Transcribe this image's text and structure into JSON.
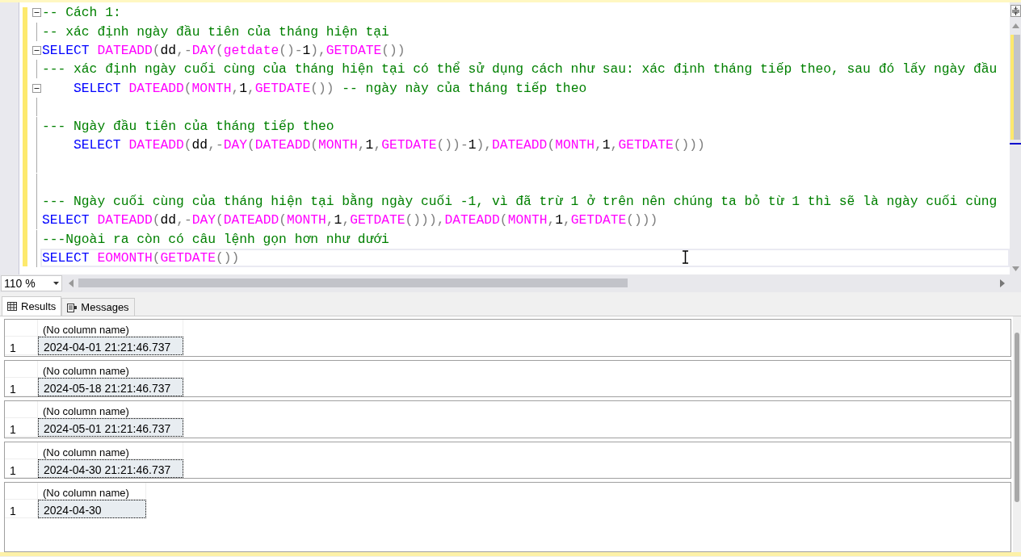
{
  "editor": {
    "lines": [
      {
        "fold": true,
        "current": false,
        "indented": false,
        "tokens": [
          {
            "kind": "comment",
            "text": "-- Cách 1:"
          }
        ]
      },
      {
        "fold": false,
        "current": false,
        "indented": false,
        "tokens": [
          {
            "kind": "comment",
            "text": "-- xác định ngày đầu tiên của tháng hiện tại"
          }
        ]
      },
      {
        "fold": true,
        "current": false,
        "indented": false,
        "tokens": [
          {
            "kind": "keyword",
            "text": "SELECT "
          },
          {
            "kind": "function",
            "text": "DATEADD"
          },
          {
            "kind": "operator",
            "text": "("
          },
          {
            "kind": "plain",
            "text": "dd"
          },
          {
            "kind": "operator",
            "text": ",-"
          },
          {
            "kind": "function",
            "text": "DAY"
          },
          {
            "kind": "operator",
            "text": "("
          },
          {
            "kind": "function",
            "text": "getdate"
          },
          {
            "kind": "operator",
            "text": "()-"
          },
          {
            "kind": "plain",
            "text": "1"
          },
          {
            "kind": "operator",
            "text": "),"
          },
          {
            "kind": "function",
            "text": "GETDATE"
          },
          {
            "kind": "operator",
            "text": "())"
          }
        ]
      },
      {
        "fold": false,
        "current": false,
        "indented": false,
        "tokens": [
          {
            "kind": "comment",
            "text": "--- xác định ngày cuối cùng của tháng hiện tại có thể sử dụng cách như sau: xác định tháng tiếp theo, sau đó lấy ngày đầu"
          }
        ]
      },
      {
        "fold": true,
        "current": false,
        "indented": true,
        "tokens": [
          {
            "kind": "keyword",
            "text": "SELECT "
          },
          {
            "kind": "function",
            "text": "DATEADD"
          },
          {
            "kind": "operator",
            "text": "("
          },
          {
            "kind": "function",
            "text": "MONTH"
          },
          {
            "kind": "operator",
            "text": ","
          },
          {
            "kind": "plain",
            "text": "1"
          },
          {
            "kind": "operator",
            "text": ","
          },
          {
            "kind": "function",
            "text": "GETDATE"
          },
          {
            "kind": "operator",
            "text": "()) "
          },
          {
            "kind": "comment",
            "text": "-- ngày này của tháng tiếp theo"
          }
        ]
      },
      {
        "fold": false
      },
      {
        "fold": false,
        "current": false,
        "indented": false,
        "tokens": [
          {
            "kind": "comment",
            "text": "--- Ngày đầu tiên của tháng tiếp theo"
          }
        ]
      },
      {
        "fold": false,
        "current": false,
        "indented": true,
        "tokens": [
          {
            "kind": "keyword",
            "text": "SELECT "
          },
          {
            "kind": "function",
            "text": "DATEADD"
          },
          {
            "kind": "operator",
            "text": "("
          },
          {
            "kind": "plain",
            "text": "dd"
          },
          {
            "kind": "operator",
            "text": ",-"
          },
          {
            "kind": "function",
            "text": "DAY"
          },
          {
            "kind": "operator",
            "text": "("
          },
          {
            "kind": "function",
            "text": "DATEADD"
          },
          {
            "kind": "operator",
            "text": "("
          },
          {
            "kind": "function",
            "text": "MONTH"
          },
          {
            "kind": "operator",
            "text": ","
          },
          {
            "kind": "plain",
            "text": "1"
          },
          {
            "kind": "operator",
            "text": ","
          },
          {
            "kind": "function",
            "text": "GETDATE"
          },
          {
            "kind": "operator",
            "text": "())-"
          },
          {
            "kind": "plain",
            "text": "1"
          },
          {
            "kind": "operator",
            "text": "),"
          },
          {
            "kind": "function",
            "text": "DATEADD"
          },
          {
            "kind": "operator",
            "text": "("
          },
          {
            "kind": "function",
            "text": "MONTH"
          },
          {
            "kind": "operator",
            "text": ","
          },
          {
            "kind": "plain",
            "text": "1"
          },
          {
            "kind": "operator",
            "text": ","
          },
          {
            "kind": "function",
            "text": "GETDATE"
          },
          {
            "kind": "operator",
            "text": "()))"
          }
        ]
      },
      {
        "fold": false
      },
      {
        "fold": false
      },
      {
        "fold": false,
        "current": false,
        "indented": false,
        "tokens": [
          {
            "kind": "comment",
            "text": "--- Ngày cuối cùng của tháng hiện tại bằng ngày cuối -1, vì đã trừ 1 ở trên nên chúng ta bỏ từ 1 thì sẽ là ngày cuối cùng"
          }
        ]
      },
      {
        "fold": false,
        "current": false,
        "indented": false,
        "tokens": [
          {
            "kind": "keyword",
            "text": "SELECT "
          },
          {
            "kind": "function",
            "text": "DATEADD"
          },
          {
            "kind": "operator",
            "text": "("
          },
          {
            "kind": "plain",
            "text": "dd"
          },
          {
            "kind": "operator",
            "text": ",-"
          },
          {
            "kind": "function",
            "text": "DAY"
          },
          {
            "kind": "operator",
            "text": "("
          },
          {
            "kind": "function",
            "text": "DATEADD"
          },
          {
            "kind": "operator",
            "text": "("
          },
          {
            "kind": "function",
            "text": "MONTH"
          },
          {
            "kind": "operator",
            "text": ","
          },
          {
            "kind": "plain",
            "text": "1"
          },
          {
            "kind": "operator",
            "text": ","
          },
          {
            "kind": "function",
            "text": "GETDATE"
          },
          {
            "kind": "operator",
            "text": "())),"
          },
          {
            "kind": "function",
            "text": "DATEADD"
          },
          {
            "kind": "operator",
            "text": "("
          },
          {
            "kind": "function",
            "text": "MONTH"
          },
          {
            "kind": "operator",
            "text": ","
          },
          {
            "kind": "plain",
            "text": "1"
          },
          {
            "kind": "operator",
            "text": ","
          },
          {
            "kind": "function",
            "text": "GETDATE"
          },
          {
            "kind": "operator",
            "text": "()))"
          }
        ]
      },
      {
        "fold": false,
        "current": false,
        "indented": false,
        "tokens": [
          {
            "kind": "comment",
            "text": "---Ngoài ra còn có câu lệnh gọn hơn như dưới"
          }
        ]
      },
      {
        "fold": false,
        "current": true,
        "indented": false,
        "tokens": [
          {
            "kind": "keyword",
            "text": "SELECT "
          },
          {
            "kind": "function",
            "text": "EOMONTH"
          },
          {
            "kind": "operator",
            "text": "("
          },
          {
            "kind": "function",
            "text": "GETDATE"
          },
          {
            "kind": "operator",
            "text": "())"
          }
        ]
      }
    ]
  },
  "zoom": {
    "value": "110 %"
  },
  "tabs": [
    {
      "label": "Results",
      "selected": true
    },
    {
      "label": "Messages",
      "selected": false
    }
  ],
  "results": [
    {
      "column": "(No column name)",
      "row_number": "1",
      "value": "2024-04-01 21:21:46.737"
    },
    {
      "column": "(No column name)",
      "row_number": "1",
      "value": "2024-05-18 21:21:46.737"
    },
    {
      "column": "(No column name)",
      "row_number": "1",
      "value": "2024-05-01 21:21:46.737"
    },
    {
      "column": "(No column name)",
      "row_number": "1",
      "value": "2024-04-30 21:21:46.737"
    },
    {
      "column": "(No column name)",
      "row_number": "1",
      "value": "2024-04-30"
    }
  ]
}
